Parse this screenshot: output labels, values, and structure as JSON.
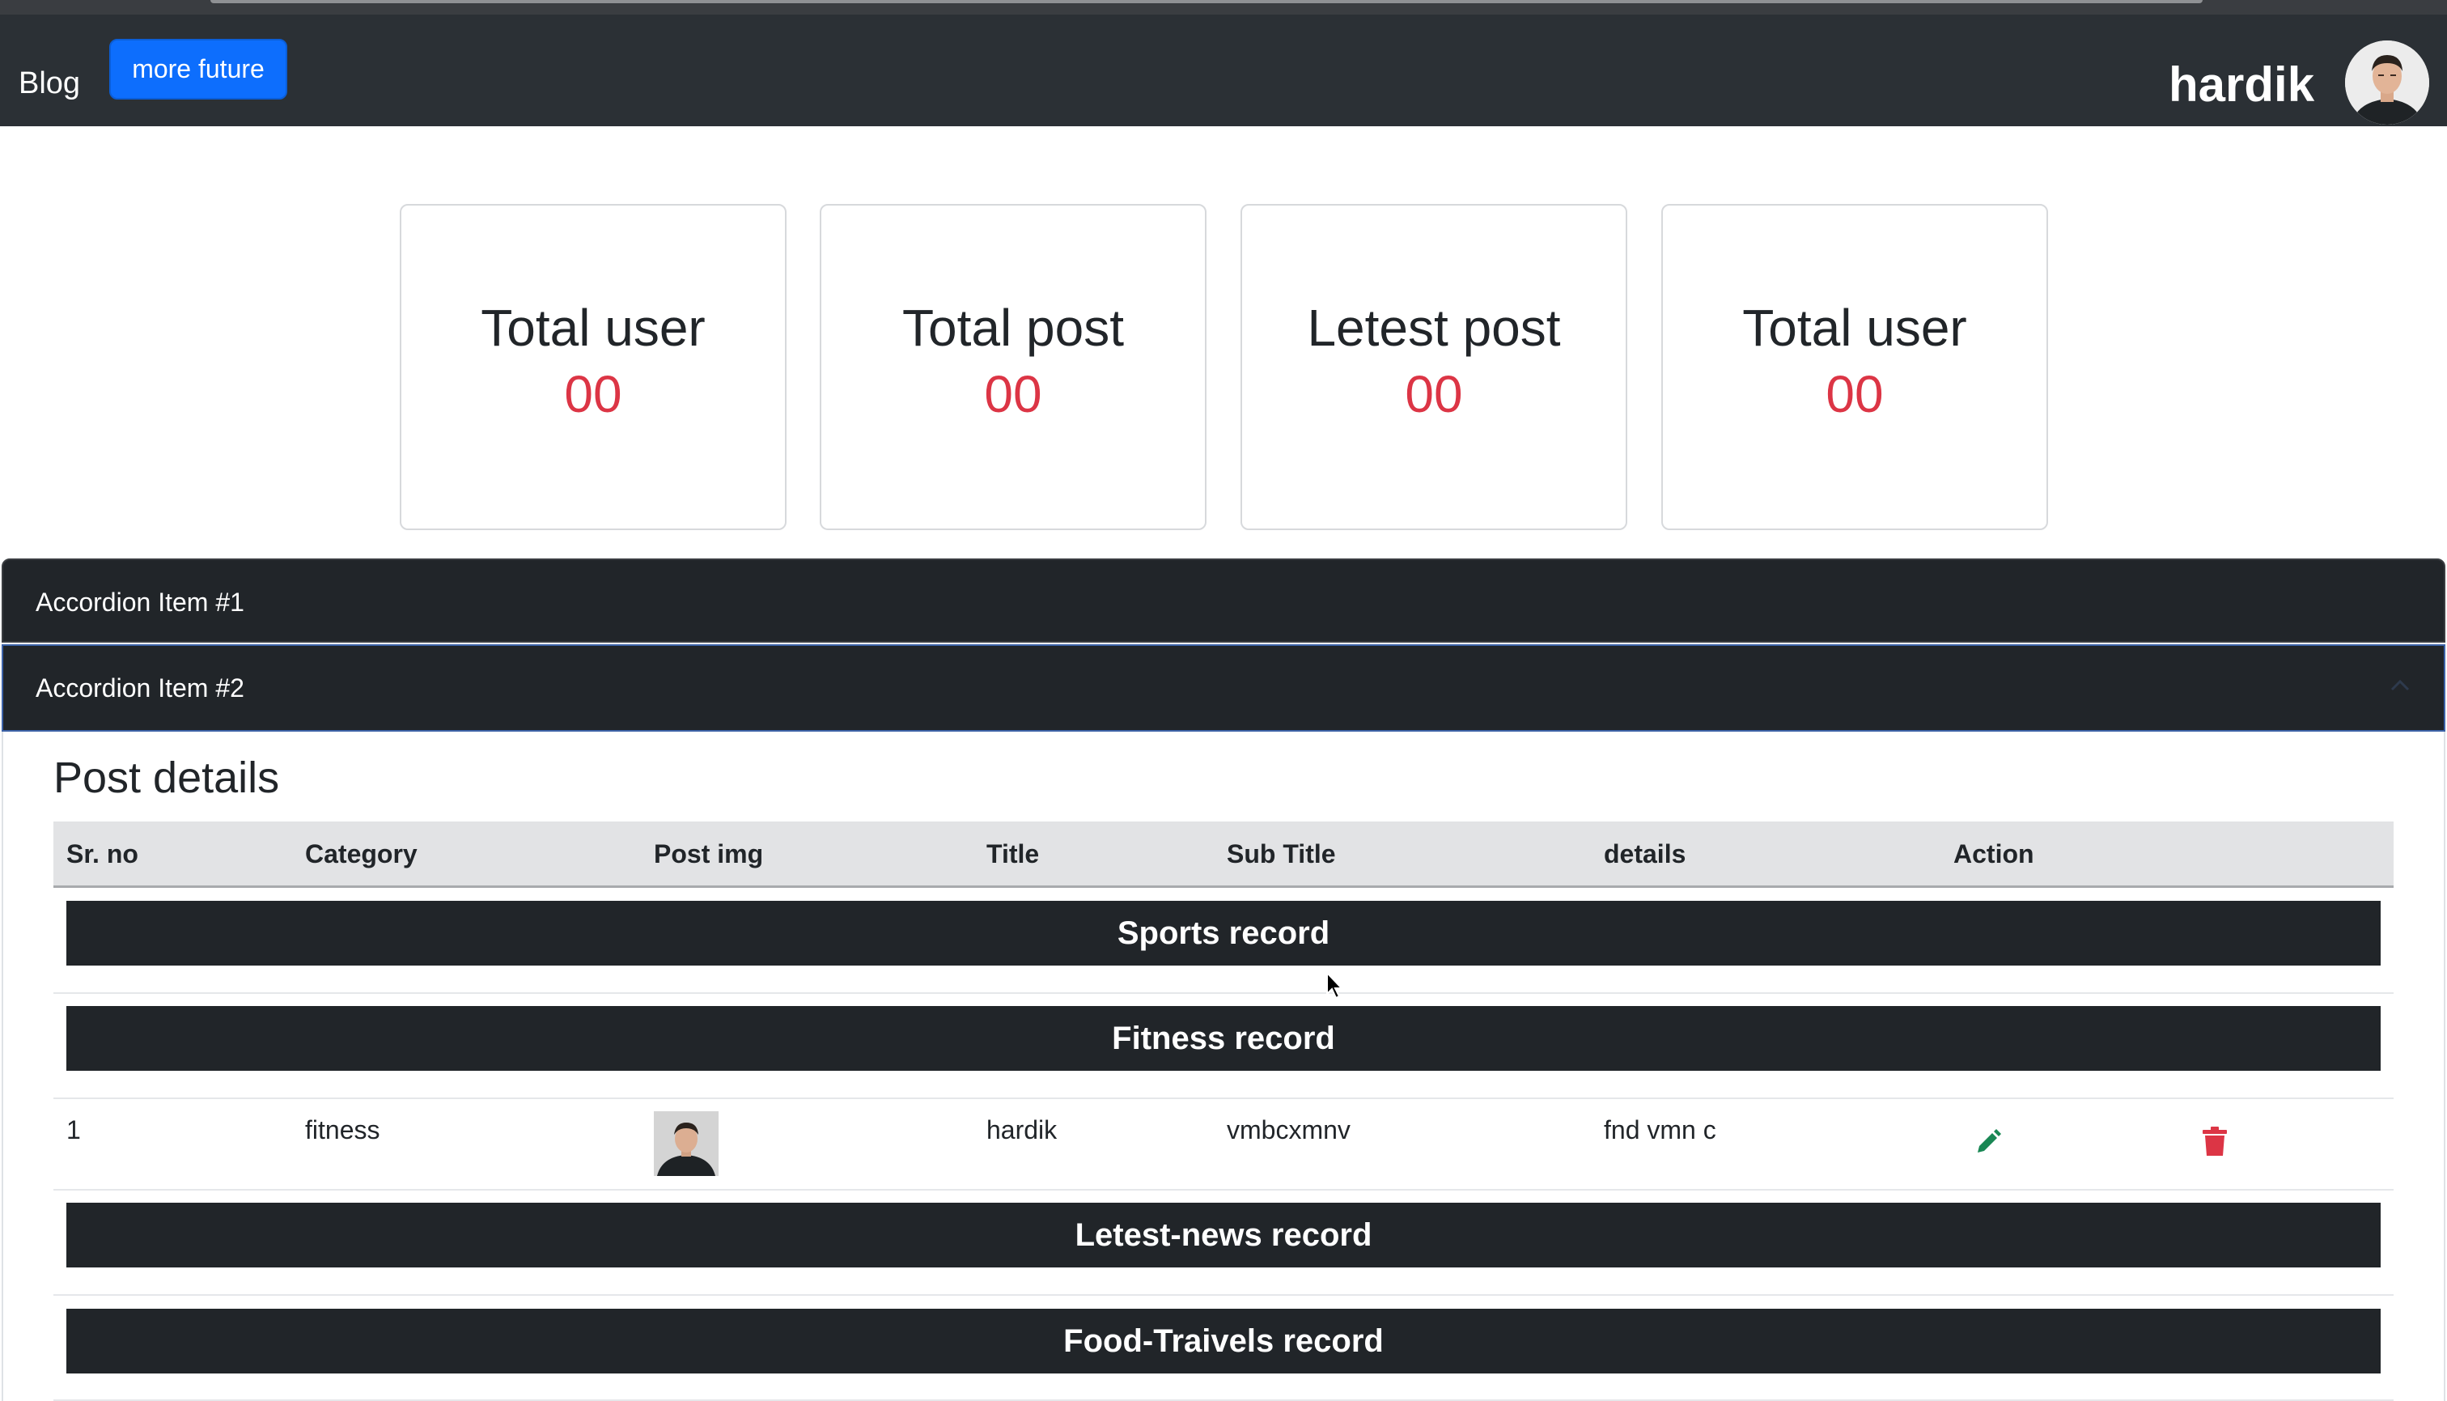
{
  "navbar": {
    "brand": "Blog",
    "button_label": "more future",
    "username": "hardik"
  },
  "stats": [
    {
      "title": "Total user",
      "value": "00"
    },
    {
      "title": "Total post",
      "value": "00"
    },
    {
      "title": "Letest post",
      "value": "00"
    },
    {
      "title": "Total user",
      "value": "00"
    }
  ],
  "accordion": {
    "item1": "Accordion Item #1",
    "item2": "Accordion Item #2"
  },
  "post_details": {
    "title": "Post details",
    "columns": [
      "Sr. no",
      "Category",
      "Post img",
      "Title",
      "Sub Title",
      "details",
      "Action"
    ],
    "groups": [
      "Sports record",
      "Fitness record",
      "Letest-news record",
      "Food-Traivels record"
    ],
    "rows": [
      {
        "sr": "1",
        "category": "fitness",
        "title": "hardik",
        "subtitle": "vmbcxmnv",
        "details": "fnd vmn c"
      }
    ]
  },
  "colors": {
    "navbar": "#2b3035",
    "primary": "#0d6efd",
    "danger": "#dc3545",
    "success": "#198754",
    "dark": "#212529"
  },
  "icons": [
    "avatar",
    "edit-icon",
    "delete-icon",
    "chevron-up-icon",
    "mouse-cursor-icon"
  ]
}
